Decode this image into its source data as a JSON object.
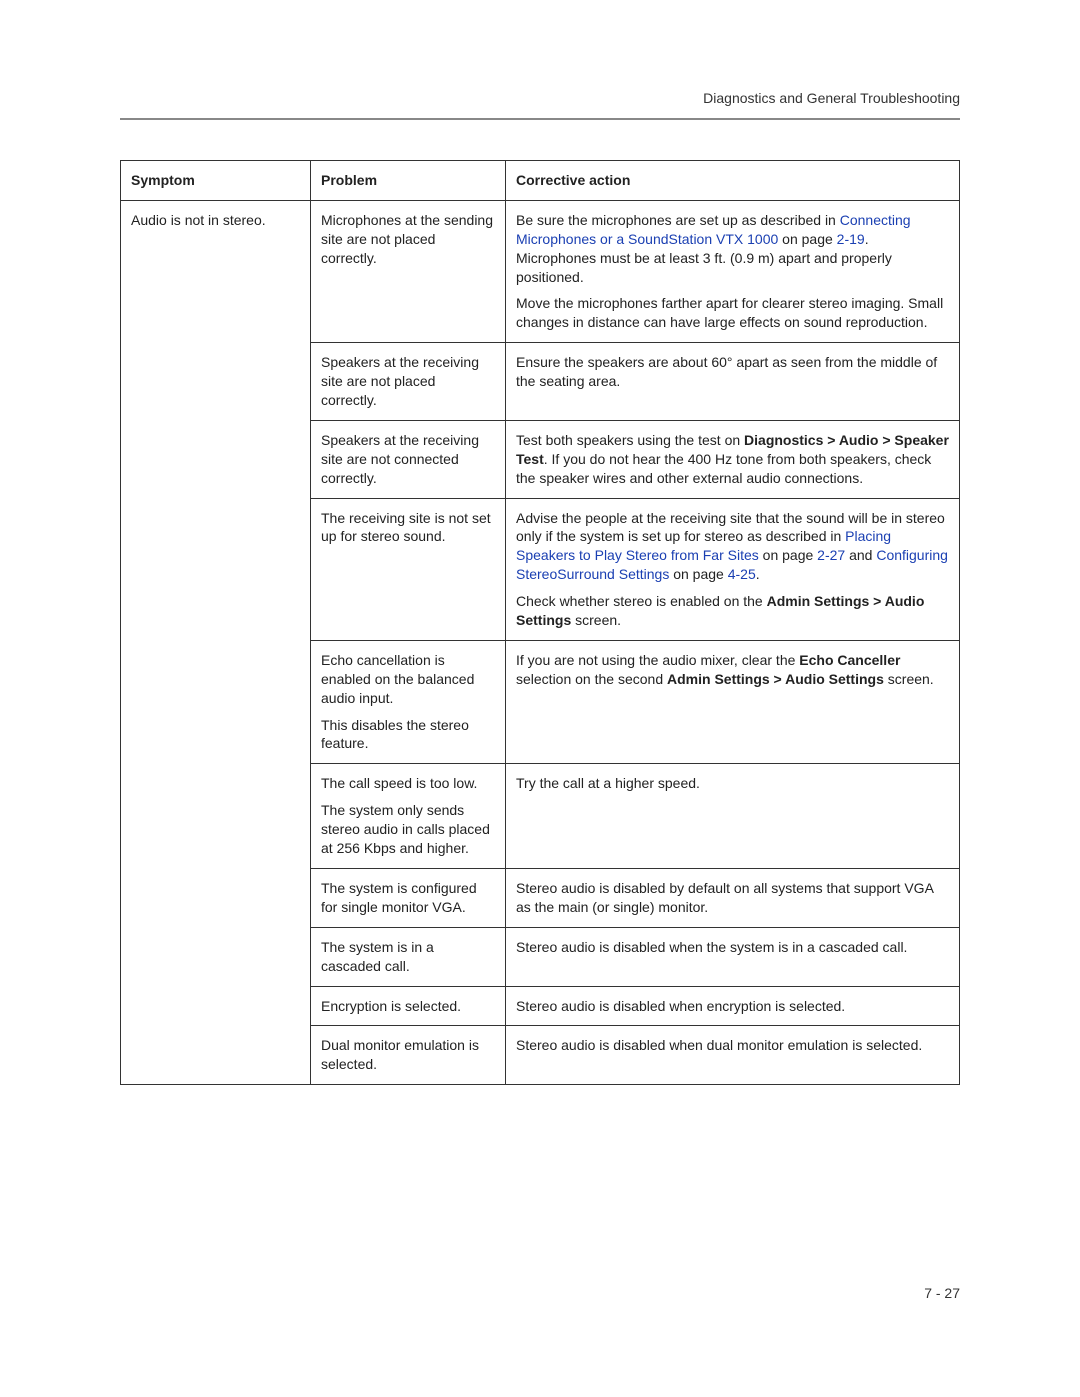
{
  "header": {
    "section_title": "Diagnostics and General Troubleshooting"
  },
  "table": {
    "headers": {
      "symptom": "Symptom",
      "problem": "Problem",
      "corrective": "Corrective action"
    },
    "symptom": "Audio is not in stereo.",
    "rows": {
      "r1": {
        "problem": "Microphones at the sending site are not placed correctly.",
        "c1a": "Be sure the microphones are set up as described in ",
        "c1link1": "Connecting Microphones or a SoundStation VTX 1000",
        "c1b": " on page ",
        "c1link2": "2-19",
        "c1c": ". Microphones must be at least 3 ft. (0.9 m) apart and properly positioned.",
        "c2": "Move the microphones farther apart for clearer stereo imaging. Small changes in distance can have large effects on sound reproduction."
      },
      "r2": {
        "problem": "Speakers at the receiving site are not placed correctly.",
        "c": "Ensure the speakers are about 60° apart as seen from the middle of the seating area."
      },
      "r3": {
        "problem": "Speakers at the receiving site are not connected correctly.",
        "c_a": "Test both speakers using the test on ",
        "c_b": "Diagnostics > Audio > Speaker Test",
        "c_c": ". If you do not hear the 400 Hz tone from both speakers, check the speaker wires and other external audio connections."
      },
      "r4": {
        "problem": "The receiving site is not set up for stereo sound.",
        "c1a": "Advise the people at the receiving site that the sound will be in stereo only if the system is set up for stereo as described in ",
        "c1link1": "Placing Speakers to Play Stereo from Far Sites",
        "c1b": " on page ",
        "c1link2": "2-27",
        "c1c": " and ",
        "c1link3": "Configuring StereoSurround Settings",
        "c1d": " on page ",
        "c1link4": "4-25",
        "c1e": ".",
        "c2a": "Check whether stereo is enabled on the ",
        "c2b": "Admin Settings > Audio Settings",
        "c2c": " screen."
      },
      "r5": {
        "p1": "Echo cancellation is enabled on the balanced audio input.",
        "p2": "This disables the stereo feature.",
        "c_a": "If you are not using the audio mixer, clear the ",
        "c_b": "Echo Canceller",
        "c_c": " selection on the second ",
        "c_d": "Admin Settings > Audio Settings",
        "c_e": " screen."
      },
      "r6": {
        "p1": "The call speed is too low.",
        "p2": "The system only sends stereo audio in calls placed at 256 Kbps and higher.",
        "c": "Try the call at a higher speed."
      },
      "r7": {
        "problem": "The system is configured for single monitor VGA.",
        "c": "Stereo audio is disabled by default on all systems that support VGA as the main (or single) monitor."
      },
      "r8": {
        "problem": "The system is in a cascaded call.",
        "c": "Stereo audio is disabled when the system is in a cascaded call."
      },
      "r9": {
        "problem": "Encryption is selected.",
        "c": "Stereo audio is disabled when encryption is selected."
      },
      "r10": {
        "problem": "Dual monitor emulation is selected.",
        "c": "Stereo audio is disabled when dual monitor emulation is selected."
      }
    }
  },
  "footer": {
    "page_number": "7 - 27"
  }
}
